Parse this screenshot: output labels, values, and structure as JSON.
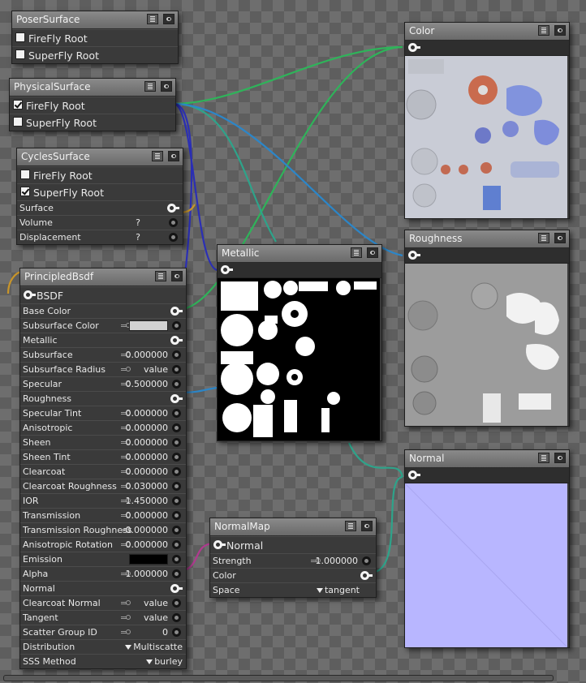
{
  "nodes": {
    "poser": {
      "title": "PoserSurface",
      "rows": [
        "FireFly Root",
        "SuperFly Root"
      ]
    },
    "physical": {
      "title": "PhysicalSurface",
      "rows": [
        "FireFly Root",
        "SuperFly Root"
      ]
    },
    "cycles": {
      "title": "CyclesSurface",
      "rows": [
        "FireFly Root",
        "SuperFly Root"
      ],
      "inputs": [
        "Surface",
        "Volume",
        "Displacement"
      ],
      "q": "?"
    },
    "principled": {
      "title": "PrincipledBsdf",
      "output": "BSDF",
      "rows": [
        {
          "label": "Base Color",
          "value": ""
        },
        {
          "label": "Subsurface Color",
          "value": ""
        },
        {
          "label": "Metallic",
          "value": ""
        },
        {
          "label": "Subsurface",
          "value": "0.000000"
        },
        {
          "label": "Subsurface Radius",
          "value": "value"
        },
        {
          "label": "Specular",
          "value": "0.500000"
        },
        {
          "label": "Roughness",
          "value": ""
        },
        {
          "label": "Specular Tint",
          "value": "0.000000"
        },
        {
          "label": "Anisotropic",
          "value": "0.000000"
        },
        {
          "label": "Sheen",
          "value": "0.000000"
        },
        {
          "label": "Sheen Tint",
          "value": "0.000000"
        },
        {
          "label": "Clearcoat",
          "value": "0.000000"
        },
        {
          "label": "Clearcoat Roughness",
          "value": "0.030000"
        },
        {
          "label": "IOR",
          "value": "1.450000"
        },
        {
          "label": "Transmission",
          "value": "0.000000"
        },
        {
          "label": "Transmission Roughness",
          "value": "0.000000"
        },
        {
          "label": "Anisotropic Rotation",
          "value": "0.000000"
        },
        {
          "label": "Emission",
          "value": ""
        },
        {
          "label": "Alpha",
          "value": "1.000000"
        },
        {
          "label": "Normal",
          "value": ""
        },
        {
          "label": "Clearcoat Normal",
          "value": "value"
        },
        {
          "label": "Tangent",
          "value": "value"
        },
        {
          "label": "Scatter Group ID",
          "value": "0"
        },
        {
          "label": "Distribution",
          "value": "Multiscatte"
        },
        {
          "label": "SSS Method",
          "value": "burley"
        }
      ]
    },
    "normalmap": {
      "title": "NormalMap",
      "output": "Normal",
      "rows": [
        {
          "label": "Strength",
          "value": "1.000000"
        },
        {
          "label": "Color",
          "value": ""
        },
        {
          "label": "Space",
          "value": "tangent"
        }
      ]
    },
    "metallic": {
      "title": "Metallic"
    },
    "color": {
      "title": "Color"
    },
    "roughness": {
      "title": "Roughness"
    },
    "normal": {
      "title": "Normal"
    }
  },
  "colors": {
    "wire_green": "#2fb35a",
    "wire_teal": "#2ea38a",
    "wire_blue": "#2c86c8",
    "wire_navy": "#2b2fb5",
    "wire_magenta": "#b03a8f",
    "wire_orange": "#c8952a",
    "subsurface_color": "#d2d2d2",
    "emission_color": "#000000",
    "color_map": "#c9ccd6",
    "roughness_map": "#9c9c9c",
    "normal_map": "#b8b6ff"
  }
}
